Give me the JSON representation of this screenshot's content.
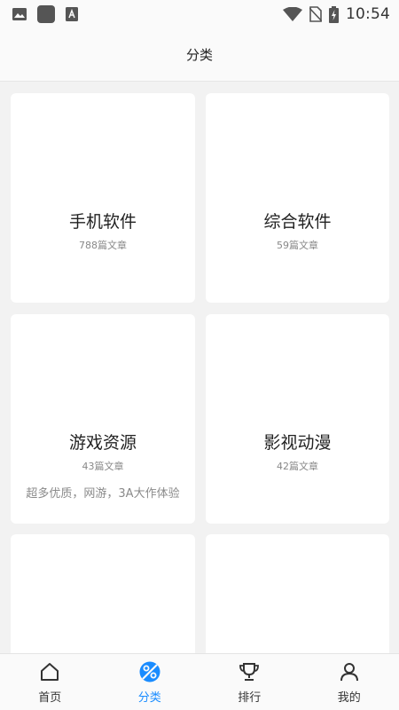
{
  "status_bar": {
    "time": "10:54",
    "left_icons": [
      "image-icon",
      "app-square-icon",
      "font-a-icon"
    ],
    "right_icons": [
      "wifi-icon",
      "no-sim-icon",
      "battery-charging-icon"
    ]
  },
  "header": {
    "title": "分类"
  },
  "categories": [
    {
      "title": "手机软件",
      "count": "788篇文章",
      "desc": ""
    },
    {
      "title": "综合软件",
      "count": "59篇文章",
      "desc": ""
    },
    {
      "title": "游戏资源",
      "count": "43篇文章",
      "desc": "超多优质，网游，3A大作体验"
    },
    {
      "title": "影视动漫",
      "count": "42篇文章",
      "desc": ""
    },
    {
      "title": "",
      "count": "",
      "desc": ""
    },
    {
      "title": "",
      "count": "",
      "desc": ""
    }
  ],
  "tabbar": {
    "accent_color": "#1a8cff",
    "items": [
      {
        "label": "首页",
        "icon": "home-icon",
        "active": false
      },
      {
        "label": "分类",
        "icon": "category-icon",
        "active": true
      },
      {
        "label": "排行",
        "icon": "trophy-icon",
        "active": false
      },
      {
        "label": "我的",
        "icon": "user-icon",
        "active": false
      }
    ]
  }
}
